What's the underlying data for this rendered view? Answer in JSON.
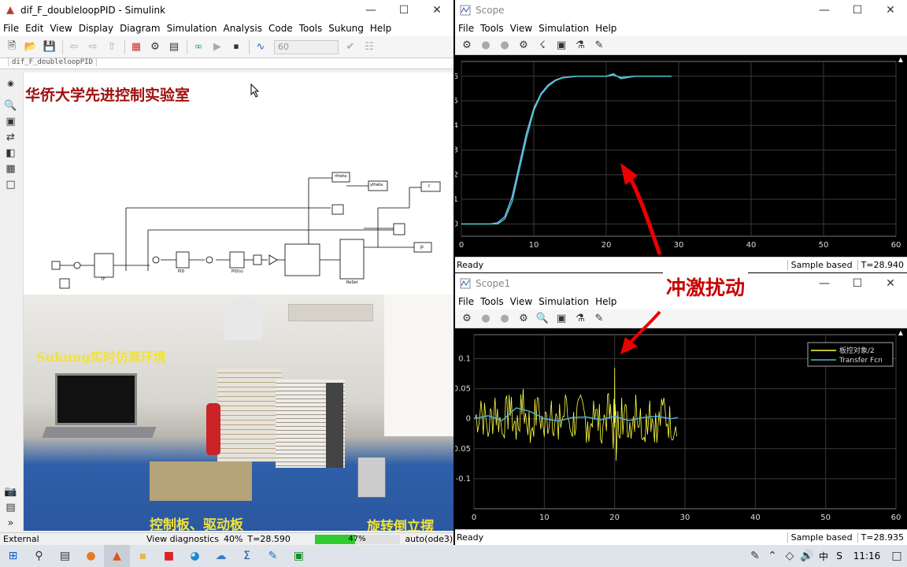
{
  "simulink": {
    "title": "dif_F_doubleloopPID - Simulink",
    "menu": [
      "File",
      "Edit",
      "View",
      "Display",
      "Diagram",
      "Simulation",
      "Analysis",
      "Code",
      "Tools",
      "Sukung",
      "Help"
    ],
    "stop_time": "60",
    "tab": "dif_F_doubleloopPID",
    "lab_title": "华侨大学先进控制实验室",
    "photo_label_env": "Sukung实时仿真环境",
    "photo_label_board": "控制板、驱动板",
    "photo_label_pendulum": "旋转倒立摆",
    "status": {
      "left": "External",
      "diag": "View diagnostics",
      "zoom": "40%",
      "time": "T=28.590",
      "progress_text": "47%",
      "progress": 0.47,
      "solver": "auto(ode3)"
    },
    "blocks": {
      "theta_out": "rtheta",
      "ytheta": "ytheta",
      "p_out": "p",
      "r_out": "r",
      "tf_label": "TF",
      "pid1": "PID",
      "pid2": "PID(s)",
      "reset": "ReSet"
    }
  },
  "scope1": {
    "title": "Scope",
    "menu": [
      "File",
      "Tools",
      "View",
      "Simulation",
      "Help"
    ],
    "status_left": "Ready",
    "sample": "Sample based",
    "time": "T=28.940",
    "y_ticks": [
      "6",
      "5",
      "4",
      "3",
      "2",
      "1",
      "0"
    ],
    "x_ticks": [
      "0",
      "10",
      "20",
      "30",
      "40",
      "50",
      "60"
    ],
    "chart_data": {
      "type": "line",
      "xlim": [
        0,
        60
      ],
      "ylim": [
        -0.5,
        6.6
      ],
      "series": [
        {
          "color": "#8ab4f8",
          "x": [
            0,
            4,
            5,
            6,
            7,
            8,
            9,
            10,
            11,
            12,
            13,
            14,
            16,
            18,
            20,
            21,
            22,
            24,
            26,
            28,
            29
          ],
          "y": [
            0,
            0,
            0.05,
            0.3,
            1.1,
            2.4,
            3.7,
            4.7,
            5.3,
            5.65,
            5.85,
            5.95,
            6.0,
            6.0,
            6.0,
            6.05,
            5.95,
            6.0,
            6.0,
            6.0,
            6.0
          ]
        },
        {
          "color": "#3fd0d0",
          "x": [
            0,
            4,
            5,
            6,
            7,
            8,
            9,
            10,
            11,
            12,
            13,
            14,
            16,
            18,
            20,
            21,
            22,
            24,
            26,
            28,
            29
          ],
          "y": [
            0,
            0,
            0.0,
            0.2,
            0.9,
            2.2,
            3.5,
            4.6,
            5.25,
            5.6,
            5.82,
            5.93,
            6.0,
            6.0,
            6.0,
            6.1,
            5.9,
            6.0,
            6.0,
            6.0,
            6.0
          ]
        }
      ]
    },
    "annotation": ""
  },
  "scope2": {
    "title": "Scope1",
    "menu": [
      "File",
      "Tools",
      "View",
      "Simulation",
      "Help"
    ],
    "status_left": "Ready",
    "sample": "Sample based",
    "time": "T=28.935",
    "y_ticks": [
      "0.1",
      "0.05",
      "0",
      "-0.05",
      "-0.1"
    ],
    "x_ticks": [
      "0",
      "10",
      "20",
      "30",
      "40",
      "50",
      "60"
    ],
    "legend": [
      "板控对象/2",
      "Transfer Fcn"
    ],
    "annotation": "冲激扰动",
    "chart_data": {
      "type": "line",
      "xlim": [
        0,
        60
      ],
      "ylim": [
        -0.15,
        0.14
      ],
      "series": [
        {
          "name": "板控对象/2",
          "color": "#ffff44",
          "x": [
            0,
            1,
            2,
            3,
            4,
            5,
            6,
            7,
            8,
            9,
            10,
            11,
            12,
            13,
            14,
            15,
            16,
            17,
            18,
            19,
            19.8,
            20,
            20.2,
            21,
            22,
            23,
            24,
            25,
            26,
            27,
            28,
            29
          ],
          "y": [
            0,
            0.03,
            -0.03,
            0.035,
            -0.025,
            0.04,
            -0.035,
            0.05,
            -0.04,
            0.035,
            -0.03,
            0.03,
            -0.035,
            0.04,
            -0.03,
            0.035,
            -0.04,
            0.03,
            -0.035,
            0.04,
            -0.05,
            0.085,
            -0.07,
            0.035,
            -0.03,
            0.04,
            -0.035,
            0.03,
            -0.04,
            0.035,
            -0.03,
            0.02
          ]
        },
        {
          "name": "Transfer Fcn",
          "color": "#4fb8e8",
          "x": [
            0,
            2,
            4,
            6,
            8,
            10,
            12,
            14,
            16,
            18,
            20,
            22,
            24,
            26,
            28,
            29
          ],
          "y": [
            0,
            0.005,
            -0.003,
            0.018,
            0.012,
            0.0,
            -0.004,
            0.002,
            0.003,
            -0.002,
            0.004,
            -0.003,
            0.002,
            0.004,
            0.0,
            0.002
          ]
        }
      ]
    }
  },
  "taskbar": {
    "clock": "11:16",
    "ime": "中",
    "ime2": "S"
  }
}
